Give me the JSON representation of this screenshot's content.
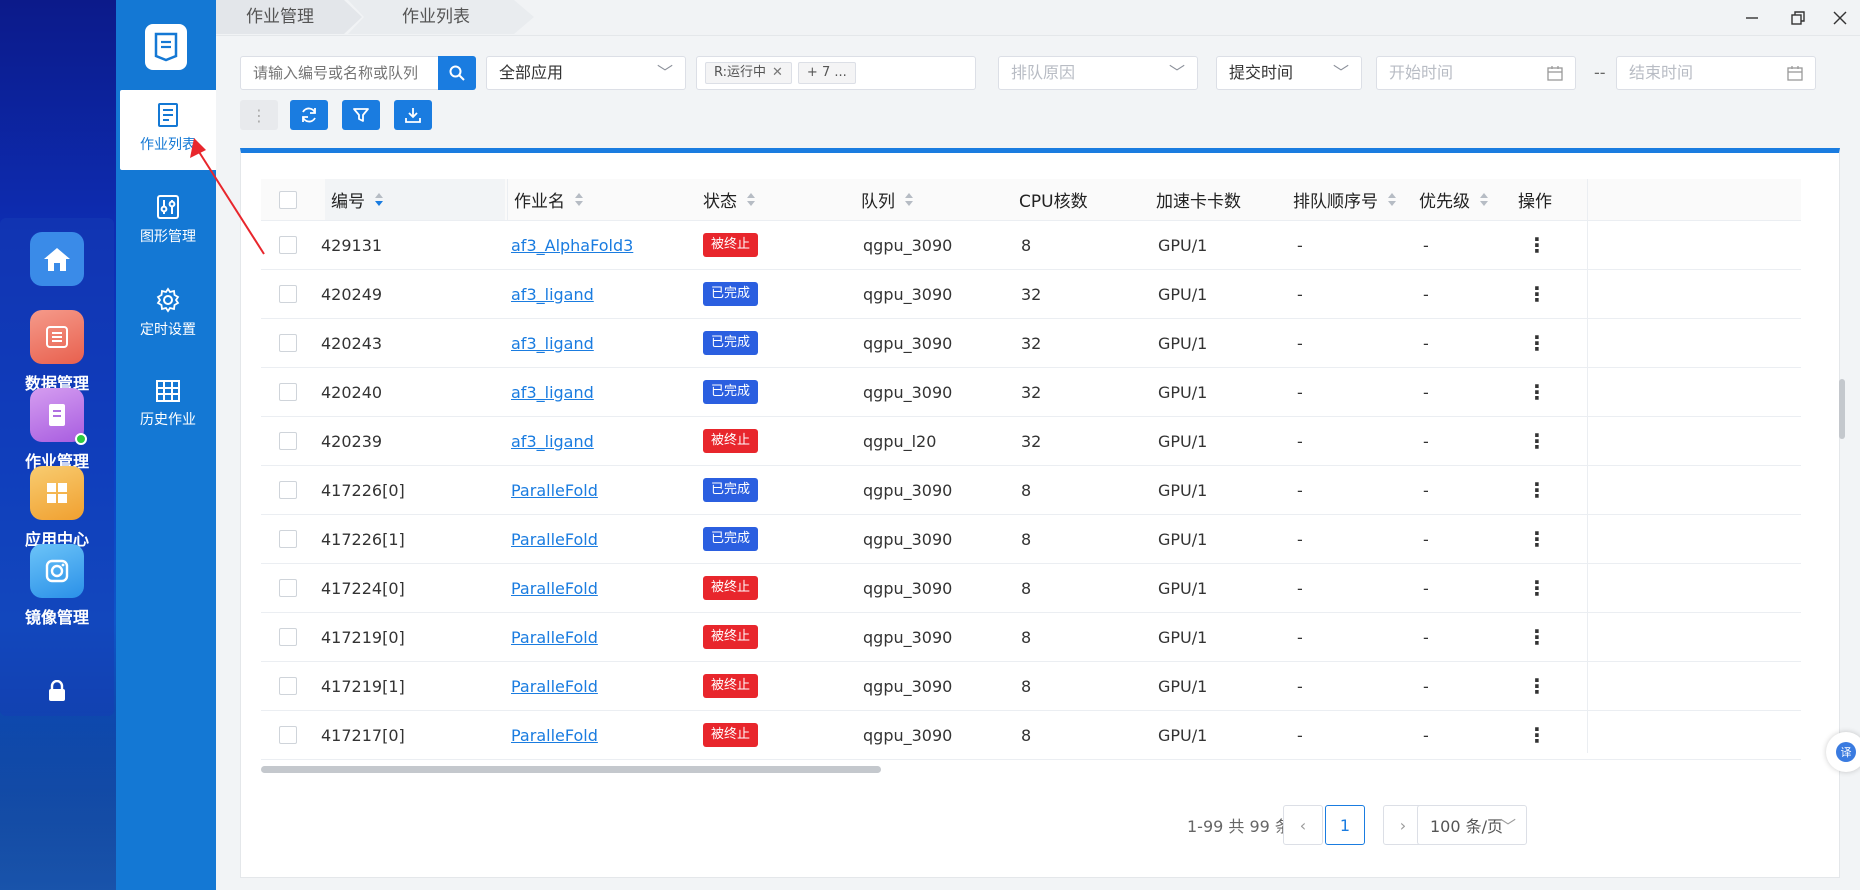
{
  "dock": [
    {
      "icon": "home-icon",
      "label": "",
      "color": "#3a8be8"
    },
    {
      "icon": "database-icon",
      "label": "数据管理",
      "color": "#f07a6a"
    },
    {
      "icon": "job-icon",
      "label": "作业管理",
      "color": "#c07de6"
    },
    {
      "icon": "apps-icon",
      "label": "应用中心",
      "color": "#f5b54a"
    },
    {
      "icon": "camera-icon",
      "label": "镜像管理",
      "color": "#3aa8f0"
    }
  ],
  "sidenav": [
    {
      "label": "作业列表",
      "icon": "list-icon",
      "active": true
    },
    {
      "label": "图形管理",
      "icon": "graphics-icon",
      "active": false
    },
    {
      "label": "定时设置",
      "icon": "gear-icon",
      "active": false
    },
    {
      "label": "历史作业",
      "icon": "grid-icon",
      "active": false
    }
  ],
  "breadcrumbs": [
    "作业管理",
    "作业列表"
  ],
  "filters": {
    "search_placeholder": "请输入编号或名称或队列",
    "app_select": "全部应用",
    "status_tags": [
      "R:运行中",
      "+ 7 ..."
    ],
    "queue_reason_placeholder": "排队原因",
    "time_select": "提交时间",
    "start_placeholder": "开始时间",
    "end_placeholder": "结束时间",
    "range_separator": "--"
  },
  "columns": [
    "编号",
    "作业名",
    "状态",
    "队列",
    "CPU核数",
    "加速卡卡数",
    "排队顺序号",
    "优先级",
    "操作"
  ],
  "status_colors": {
    "被终止": "#e8262c",
    "已完成": "#2b5fe0"
  },
  "rows": [
    {
      "id": "429131",
      "name": "af3_AlphaFold3",
      "status": "被终止",
      "queue": "qgpu_3090",
      "cpu": "8",
      "gpu": "GPU/1",
      "order": "-",
      "priority": "-"
    },
    {
      "id": "420249",
      "name": "af3_ligand",
      "status": "已完成",
      "queue": "qgpu_3090",
      "cpu": "32",
      "gpu": "GPU/1",
      "order": "-",
      "priority": "-"
    },
    {
      "id": "420243",
      "name": "af3_ligand",
      "status": "已完成",
      "queue": "qgpu_3090",
      "cpu": "32",
      "gpu": "GPU/1",
      "order": "-",
      "priority": "-"
    },
    {
      "id": "420240",
      "name": "af3_ligand",
      "status": "已完成",
      "queue": "qgpu_3090",
      "cpu": "32",
      "gpu": "GPU/1",
      "order": "-",
      "priority": "-"
    },
    {
      "id": "420239",
      "name": "af3_ligand",
      "status": "被终止",
      "queue": "qgpu_l20",
      "cpu": "32",
      "gpu": "GPU/1",
      "order": "-",
      "priority": "-"
    },
    {
      "id": "417226[0]",
      "name": "ParalleFold",
      "status": "已完成",
      "queue": "qgpu_3090",
      "cpu": "8",
      "gpu": "GPU/1",
      "order": "-",
      "priority": "-"
    },
    {
      "id": "417226[1]",
      "name": "ParalleFold",
      "status": "已完成",
      "queue": "qgpu_3090",
      "cpu": "8",
      "gpu": "GPU/1",
      "order": "-",
      "priority": "-"
    },
    {
      "id": "417224[0]",
      "name": "ParalleFold",
      "status": "被终止",
      "queue": "qgpu_3090",
      "cpu": "8",
      "gpu": "GPU/1",
      "order": "-",
      "priority": "-"
    },
    {
      "id": "417219[0]",
      "name": "ParalleFold",
      "status": "被终止",
      "queue": "qgpu_3090",
      "cpu": "8",
      "gpu": "GPU/1",
      "order": "-",
      "priority": "-"
    },
    {
      "id": "417219[1]",
      "name": "ParalleFold",
      "status": "被终止",
      "queue": "qgpu_3090",
      "cpu": "8",
      "gpu": "GPU/1",
      "order": "-",
      "priority": "-"
    },
    {
      "id": "417217[0]",
      "name": "ParalleFold",
      "status": "被终止",
      "queue": "qgpu_3090",
      "cpu": "8",
      "gpu": "GPU/1",
      "order": "-",
      "priority": "-"
    }
  ],
  "pagination": {
    "summary": "1-99 共 99 条",
    "current_page": "1",
    "page_size": "100 条/页"
  },
  "colors": {
    "accent": "#1a7ce0",
    "sidebar": "#1478d4"
  }
}
